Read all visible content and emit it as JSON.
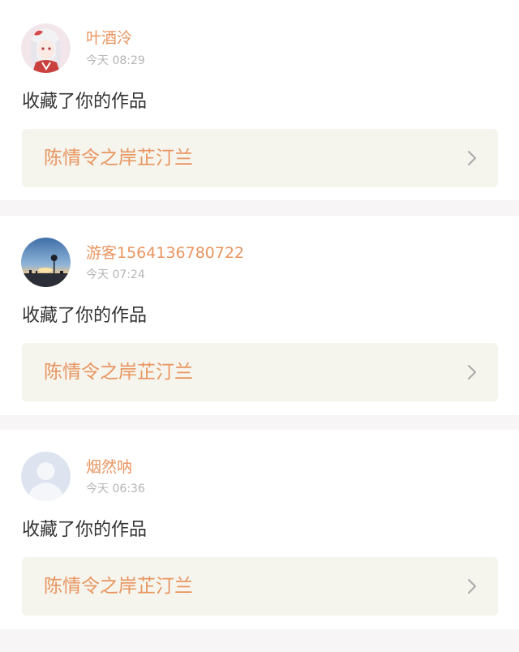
{
  "notifications": [
    {
      "username": "叶酒泠",
      "time": "今天 08:29",
      "action": "收藏了你的作品",
      "work_title": "陈情令之岸芷汀兰",
      "avatar_icon": "anime-girl-avatar"
    },
    {
      "username": "游客1564136780722",
      "time": "今天 07:24",
      "action": "收藏了你的作品",
      "work_title": "陈情令之岸芷汀兰",
      "avatar_icon": "sunset-landscape-avatar"
    },
    {
      "username": "烟然呐",
      "time": "今天 06:36",
      "action": "收藏了你的作品",
      "work_title": "陈情令之岸芷汀兰",
      "avatar_icon": "default-person-avatar"
    }
  ],
  "colors": {
    "accent": "#e8955f",
    "text": "#333333",
    "muted": "#b5b5b5",
    "link_bg": "#f5f4ed",
    "page_bg": "#f7f5f5"
  }
}
